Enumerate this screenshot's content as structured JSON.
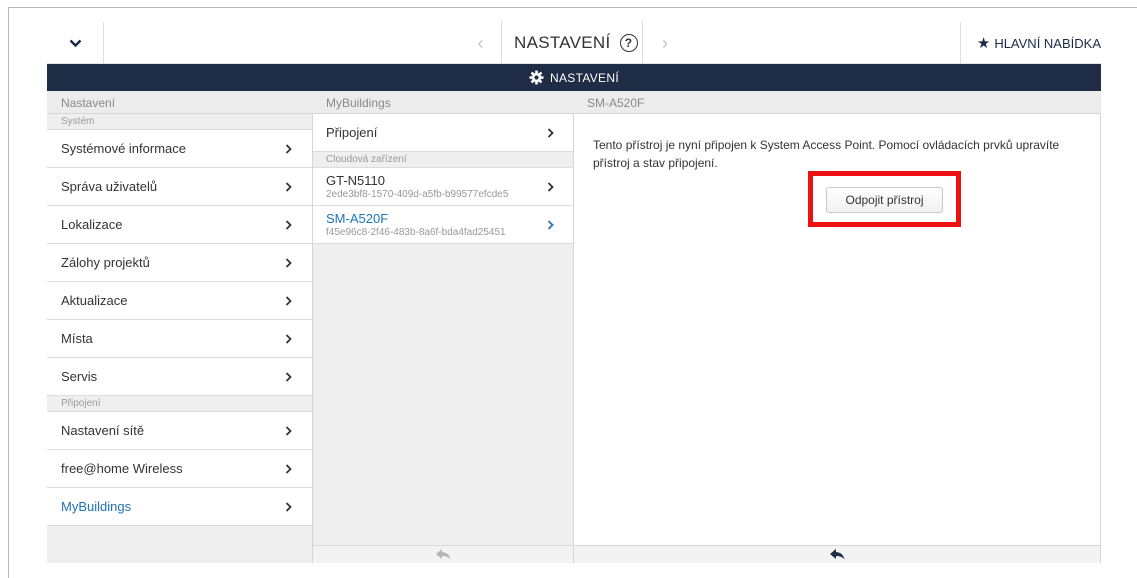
{
  "topbar": {
    "title": "NASTAVENÍ",
    "help_symbol": "?",
    "prev_symbol": "‹",
    "next_symbol": "›",
    "main_menu_label": "HLAVNÍ NABÍDKA",
    "main_menu_icon": "star-icon",
    "collapse_icon": "chevron-down-icon"
  },
  "header": {
    "title": "NASTAVENÍ",
    "icon": "gear-icon"
  },
  "columns": {
    "col1_title": "Nastavení",
    "col2_title": "MyBuildings",
    "col3_title": "SM-A520F"
  },
  "sidebar": {
    "section_system": "Systém",
    "section_connection": "Připojení",
    "items": [
      {
        "label": "Systémové informace"
      },
      {
        "label": "Správa uživatelů"
      },
      {
        "label": "Lokalizace"
      },
      {
        "label": "Zálohy projektů"
      },
      {
        "label": "Aktualizace"
      },
      {
        "label": "Místa"
      },
      {
        "label": "Servis"
      },
      {
        "label": "Nastavení sítě"
      },
      {
        "label": "free@home Wireless"
      },
      {
        "label": "MyBuildings",
        "selected": true
      }
    ]
  },
  "mybuildings": {
    "connection_label": "Připojení",
    "section_cloud": "Cloudová zařízení",
    "devices": [
      {
        "name": "GT-N5110",
        "id": "2ede3bf8-1570-409d-a5fb-b99577efcde5"
      },
      {
        "name": "SM-A520F",
        "id": "f45e96c8-2f46-483b-8a6f-bda4fad25451",
        "selected": true
      }
    ]
  },
  "detail": {
    "message": "Tento přístroj je nyní připojen k System Access Point. Pomocí ovládacích prvků upravíte přístroj a stav připojení.",
    "disconnect_label": "Odpojit přístroj"
  },
  "colors": {
    "header_bg": "#1e2c45",
    "selected_text": "#2073b8",
    "highlight": "#ee1111"
  }
}
